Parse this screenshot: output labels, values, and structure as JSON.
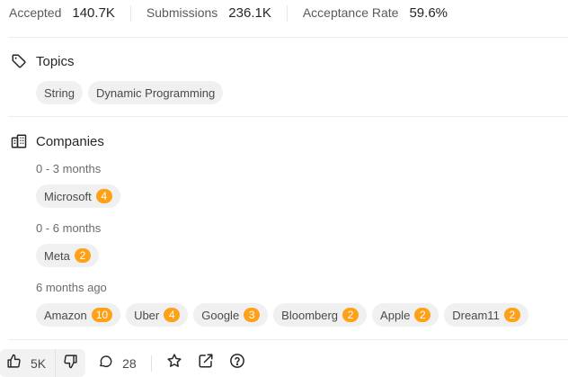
{
  "stats": {
    "accepted_label": "Accepted",
    "accepted_value": "140.7K",
    "submissions_label": "Submissions",
    "submissions_value": "236.1K",
    "acceptance_label": "Acceptance Rate",
    "acceptance_value": "59.6%"
  },
  "topics": {
    "title": "Topics",
    "tags": [
      "String",
      "Dynamic Programming"
    ]
  },
  "companies": {
    "title": "Companies",
    "groups": [
      {
        "period": "0 - 3 months",
        "items": [
          {
            "name": "Microsoft",
            "count": "4"
          }
        ]
      },
      {
        "period": "0 - 6 months",
        "items": [
          {
            "name": "Meta",
            "count": "2"
          }
        ]
      },
      {
        "period": "6 months ago",
        "items": [
          {
            "name": "Amazon",
            "count": "10"
          },
          {
            "name": "Uber",
            "count": "4"
          },
          {
            "name": "Google",
            "count": "3"
          },
          {
            "name": "Bloomberg",
            "count": "2"
          },
          {
            "name": "Apple",
            "count": "2"
          },
          {
            "name": "Dream11",
            "count": "2"
          }
        ]
      }
    ]
  },
  "footer": {
    "likes": "5K",
    "comments": "28"
  },
  "colors": {
    "badge": "#ffa116",
    "chip_bg": "#f0f0f0",
    "divider": "#ebebeb"
  },
  "icons": [
    "tag-icon",
    "building-icon",
    "thumbs-up-icon",
    "thumbs-down-icon",
    "comment-icon",
    "star-icon",
    "share-icon",
    "help-icon"
  ]
}
